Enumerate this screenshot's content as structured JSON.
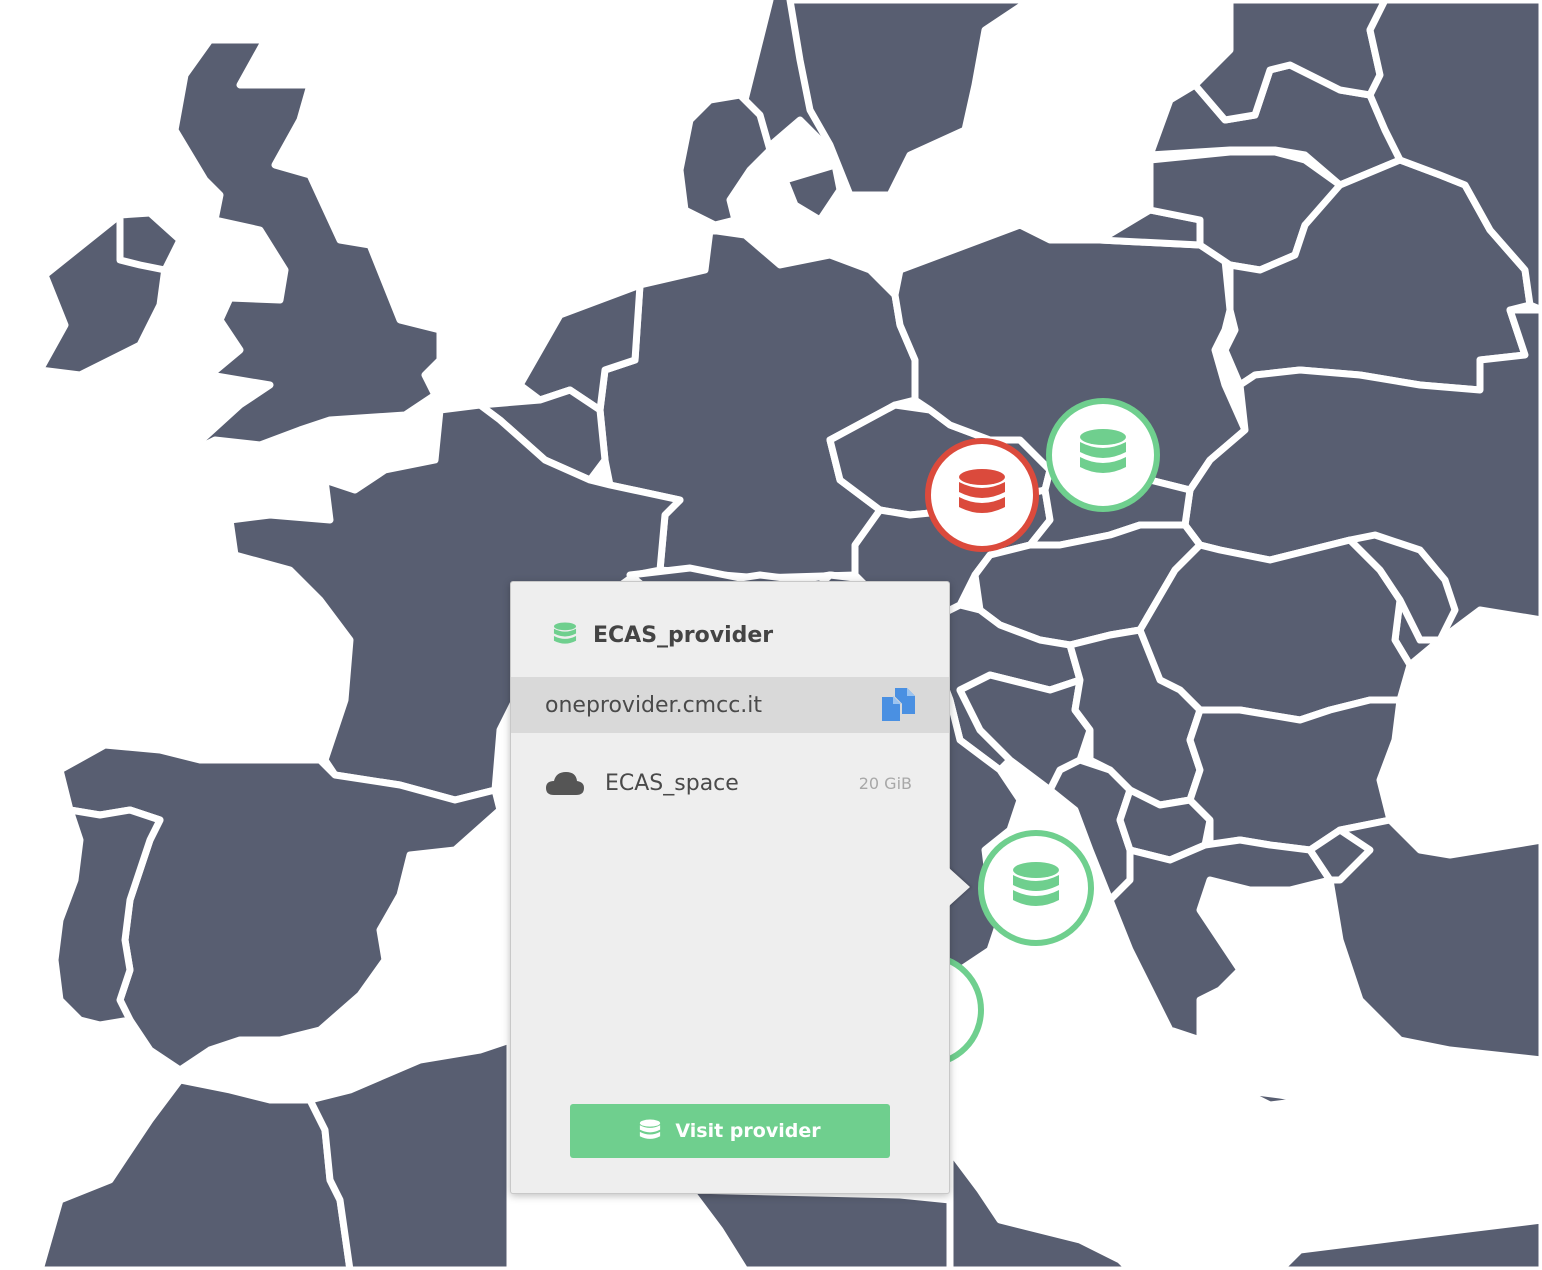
{
  "colors": {
    "land": "#585e71",
    "sea": "#ffffff",
    "provider_online": "#6fcf8e",
    "provider_offline": "#db4a3c",
    "popup_bg": "#eeeeee",
    "host_row_bg": "#d9d9d9",
    "copy_icon": "#4a90e2"
  },
  "map": {
    "providers": [
      {
        "status": "offline",
        "icon": "database-icon"
      },
      {
        "status": "online",
        "icon": "database-icon"
      },
      {
        "status": "online",
        "icon": "database-icon",
        "selected": true
      },
      {
        "status": "online",
        "icon": "database-icon",
        "partially_hidden": true
      }
    ]
  },
  "popup": {
    "provider_name": "ECAS_provider",
    "provider_icon": "database-icon",
    "hostname": "oneprovider.cmcc.it",
    "copy_icon": "copy-icon",
    "spaces": [
      {
        "name": "ECAS_space",
        "size": "20 GiB",
        "icon": "cloud-icon"
      }
    ],
    "visit_button_label": "Visit provider",
    "visit_button_icon": "database-icon"
  }
}
